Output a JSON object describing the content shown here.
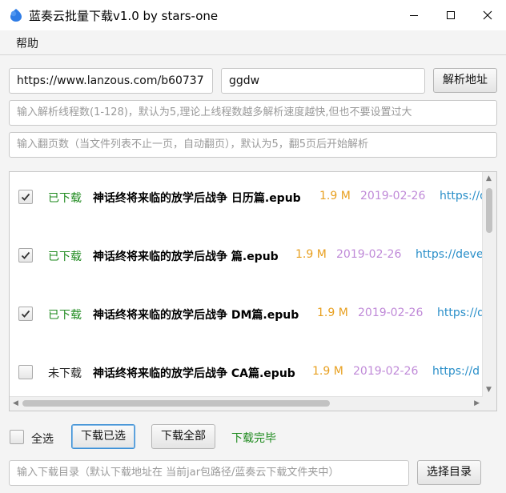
{
  "window": {
    "title": "蓝奏云批量下载v1.0 by stars-one",
    "minimize_icon": "minimize-icon",
    "maximize_icon": "maximize-icon",
    "close_icon": "close-icon"
  },
  "menu": {
    "items": [
      {
        "label": "帮助"
      }
    ]
  },
  "form": {
    "url_value": "https://www.lanzous.com/b60737",
    "password_value": "ggdw",
    "parse_button": "解析地址",
    "threads_placeholder": "输入解析线程数(1-128)，默认为5,理论上线程数越多解析速度越快,但也不要设置过大",
    "pages_placeholder": "输入翻页数（当文件列表不止一页，自动翻页），默认为5，翻5页后开始解析"
  },
  "files": [
    {
      "checked": true,
      "status": "已下载",
      "name": "神话终将来临的放学后战争 日历篇.epub",
      "size": "1.9 M",
      "date": "2019-02-26",
      "url": "https://d"
    },
    {
      "checked": true,
      "status": "已下载",
      "name": "神话终将来临的放学后战争 篇.epub",
      "size": "1.9 M",
      "date": "2019-02-26",
      "url": "https://deve"
    },
    {
      "checked": true,
      "status": "已下载",
      "name": "神话终将来临的放学后战争 DM篇.epub",
      "size": "1.9 M",
      "date": "2019-02-26",
      "url": "https://d"
    },
    {
      "checked": false,
      "status": "未下载",
      "name": "神话终将来临的放学后战争 CA篇.epub",
      "size": "1.9 M",
      "date": "2019-02-26",
      "url": "https://d"
    }
  ],
  "actions": {
    "select_all_label": "全选",
    "download_selected": "下载已选",
    "download_all": "下载全部",
    "status_text": "下载完毕"
  },
  "footer": {
    "dir_placeholder": "输入下载目录（默认下载地址在 当前jar包路径/蓝奏云下载文件夹中）",
    "choose_dir_button": "选择目录"
  },
  "colors": {
    "status_downloaded": "#1e8a1e",
    "status_not_downloaded": "#222222",
    "size": "#e8a020",
    "date": "#c08ad8",
    "url": "#2a8fc9",
    "done_text": "#1e8a1e",
    "accent": "#3c8fd4",
    "app_icon": "#2e7ce6"
  }
}
